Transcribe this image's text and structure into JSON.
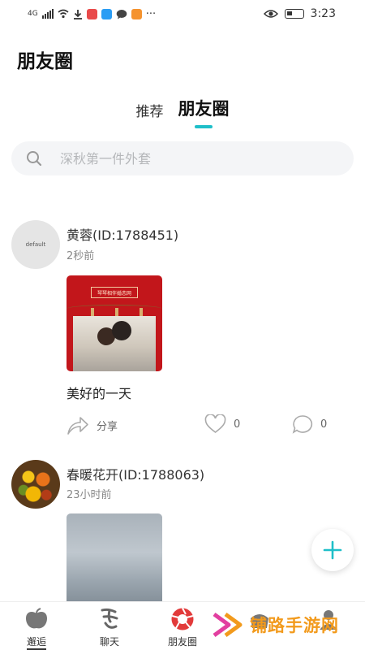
{
  "status_bar": {
    "network": "4G",
    "time": "3:23",
    "notification_apps": [
      {
        "name": "red-app-icon",
        "color": "#e94a4a"
      },
      {
        "name": "blue-app-icon",
        "color": "#2a9df4"
      },
      {
        "name": "chat-bubble-icon",
        "color": "#444444"
      },
      {
        "name": "orange-app-icon",
        "color": "#f5932e"
      }
    ],
    "more": "···"
  },
  "header": {
    "title": "朋友圈"
  },
  "tabs": [
    {
      "label": "推荐",
      "active": false
    },
    {
      "label": "朋友圈",
      "active": true
    }
  ],
  "accent_color": "#1fbfc9",
  "search": {
    "placeholder": "深秋第一件外套"
  },
  "posts": [
    {
      "avatar_text": "default",
      "username": "黄蓉(ID:1788451)",
      "time": "2秒前",
      "image_banner_text": "琴琴相伴婚恋网",
      "caption": "美好的一天",
      "share_label": "分享",
      "likes": "0",
      "comments": "0"
    },
    {
      "avatar_text": "",
      "username": "春暖花开(ID:1788063)",
      "time": "23小时前"
    }
  ],
  "bottom_nav": [
    {
      "label": "邂逅",
      "icon": "apple-icon",
      "active": true
    },
    {
      "label": "聊天",
      "icon": "calligraphy-icon",
      "active": false
    },
    {
      "label": "朋友圈",
      "icon": "camera-aperture-icon",
      "active": false
    }
  ],
  "watermark": {
    "text": "铺路手游网"
  }
}
